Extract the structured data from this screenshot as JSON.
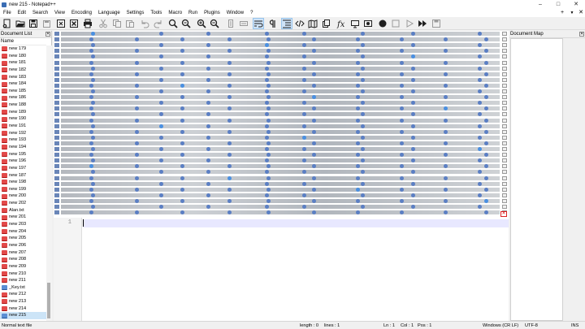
{
  "window": {
    "title": "new 215 - Notepad++",
    "minimize": "–",
    "maximize": "□",
    "close": "✕"
  },
  "menus": [
    "File",
    "Edit",
    "Search",
    "View",
    "Encoding",
    "Language",
    "Settings",
    "Tools",
    "Macro",
    "Run",
    "Plugins",
    "Window",
    "?"
  ],
  "menu_right": {
    "add": "+",
    "dropdown": "▼",
    "close": "✕"
  },
  "toolbar": [
    {
      "name": "new-file-icon",
      "icon": "new-file",
      "color": "#1f1f1f"
    },
    {
      "name": "open-file-icon",
      "icon": "open-file",
      "color": "#1f1f1f"
    },
    {
      "name": "save-icon",
      "icon": "save",
      "color": "#1f1f1f"
    },
    {
      "name": "save-all-icon",
      "icon": "save-all",
      "color": "#9a9a9a"
    },
    {
      "name": "close-icon",
      "icon": "close",
      "color": "#1f1f1f"
    },
    {
      "name": "close-all-icon",
      "icon": "close-all",
      "color": "#1f1f1f"
    },
    {
      "name": "print-icon",
      "icon": "print",
      "color": "#1f1f1f"
    },
    {
      "name": "cut-icon",
      "icon": "cut",
      "color": "#9a9a9a"
    },
    {
      "name": "copy-icon",
      "icon": "copy",
      "color": "#9a9a9a"
    },
    {
      "name": "paste-icon",
      "icon": "paste",
      "color": "#9a9a9a"
    },
    {
      "name": "undo-icon",
      "icon": "undo",
      "color": "#9a9a9a"
    },
    {
      "name": "redo-icon",
      "icon": "redo",
      "color": "#9a9a9a"
    },
    {
      "name": "find-icon",
      "icon": "find",
      "color": "#1f1f1f"
    },
    {
      "name": "replace-icon",
      "icon": "replace",
      "color": "#1f1f1f"
    },
    {
      "name": "zoom-in-icon",
      "icon": "zoom-in",
      "color": "#1f1f1f"
    },
    {
      "name": "zoom-out-icon",
      "icon": "zoom-out",
      "color": "#1f1f1f"
    },
    {
      "name": "sync-vertical-icon",
      "icon": "sync-v",
      "color": "#9a9a9a"
    },
    {
      "name": "sync-horizontal-icon",
      "icon": "sync-h",
      "color": "#9a9a9a"
    },
    {
      "name": "word-wrap-icon",
      "icon": "wrap",
      "color": "#1f1f1f",
      "active": true
    },
    {
      "name": "show-all-characters-icon",
      "icon": "pilcrow",
      "color": "#1f1f1f"
    },
    {
      "name": "indent-guide-icon",
      "icon": "indent",
      "color": "#1f1f1f",
      "active": true
    },
    {
      "name": "xml-tag-icon",
      "icon": "tag",
      "color": "#1f1f1f"
    },
    {
      "name": "document-map-icon",
      "icon": "map",
      "color": "#1f1f1f"
    },
    {
      "name": "document-list-icon",
      "icon": "doclist",
      "color": "#1f1f1f"
    },
    {
      "name": "function-list-icon",
      "icon": "fx",
      "color": "#1f1f1f"
    },
    {
      "name": "monitoring-icon",
      "icon": "monitor",
      "color": "#1f1f1f"
    },
    {
      "name": "folder-as-workspace-icon",
      "icon": "workspace",
      "color": "#1f1f1f"
    },
    {
      "name": "record-macro-icon",
      "icon": "record",
      "color": "#1f1f1f"
    },
    {
      "name": "stop-recording-icon",
      "icon": "stop",
      "color": "#9a9a9a"
    },
    {
      "name": "play-macro-icon",
      "icon": "play",
      "color": "#9a9a9a"
    },
    {
      "name": "run-macro-multiple-icon",
      "icon": "ffwd",
      "color": "#1f1f1f"
    },
    {
      "name": "save-macro-icon",
      "icon": "save-macro",
      "color": "#9a9a9a"
    }
  ],
  "document_list": {
    "title": "Document List",
    "close": "✕",
    "column_header": "Name",
    "items": [
      {
        "label": "new 179",
        "icon": "red"
      },
      {
        "label": "new 180",
        "icon": "red"
      },
      {
        "label": "new 181",
        "icon": "red"
      },
      {
        "label": "new 182",
        "icon": "red"
      },
      {
        "label": "new 183",
        "icon": "red"
      },
      {
        "label": "new 184",
        "icon": "red"
      },
      {
        "label": "new 185",
        "icon": "red"
      },
      {
        "label": "new 186",
        "icon": "red"
      },
      {
        "label": "new 188",
        "icon": "red"
      },
      {
        "label": "new 189",
        "icon": "red"
      },
      {
        "label": "new 190",
        "icon": "red"
      },
      {
        "label": "new 191",
        "icon": "red"
      },
      {
        "label": "new 192",
        "icon": "red"
      },
      {
        "label": "new 193",
        "icon": "red"
      },
      {
        "label": "new 194",
        "icon": "red"
      },
      {
        "label": "new 195",
        "icon": "red"
      },
      {
        "label": "new 196",
        "icon": "red"
      },
      {
        "label": "new 197",
        "icon": "red"
      },
      {
        "label": "new 187",
        "icon": "red"
      },
      {
        "label": "new 198",
        "icon": "red"
      },
      {
        "label": "new 199",
        "icon": "red"
      },
      {
        "label": "new 200",
        "icon": "red"
      },
      {
        "label": "new 202",
        "icon": "red"
      },
      {
        "label": "Alan.txt",
        "icon": "red"
      },
      {
        "label": "new 201",
        "icon": "red"
      },
      {
        "label": "new 203",
        "icon": "red"
      },
      {
        "label": "new 204",
        "icon": "red"
      },
      {
        "label": "new 205",
        "icon": "red"
      },
      {
        "label": "new 206",
        "icon": "red"
      },
      {
        "label": "new 207",
        "icon": "red"
      },
      {
        "label": "new 208",
        "icon": "red"
      },
      {
        "label": "new 209",
        "icon": "red"
      },
      {
        "label": "new 210",
        "icon": "red"
      },
      {
        "label": "new 211",
        "icon": "red"
      },
      {
        "label": "_Key.txt",
        "icon": "blue"
      },
      {
        "label": "new 212",
        "icon": "red"
      },
      {
        "label": "new 213",
        "icon": "red"
      },
      {
        "label": "new 214",
        "icon": "red"
      },
      {
        "label": "new 215",
        "icon": "blue",
        "selected": true
      }
    ]
  },
  "editor": {
    "line_number": "1",
    "current_line_color": "#e8e8ff"
  },
  "document_map": {
    "title": "Document Map",
    "close": "✕"
  },
  "results_pane": {
    "close": "✕",
    "highlight_color": "#4a90e2",
    "match_color": "#5b7fc4"
  },
  "statusbar": {
    "file_type": "Normal text file",
    "length": "length : 0",
    "lines": "lines : 1",
    "ln": "Ln : 1",
    "col": "Col : 1",
    "pos": "Pos : 1",
    "eol": "Windows (CR LF)",
    "encoding": "UTF-8",
    "mode": "INS"
  }
}
